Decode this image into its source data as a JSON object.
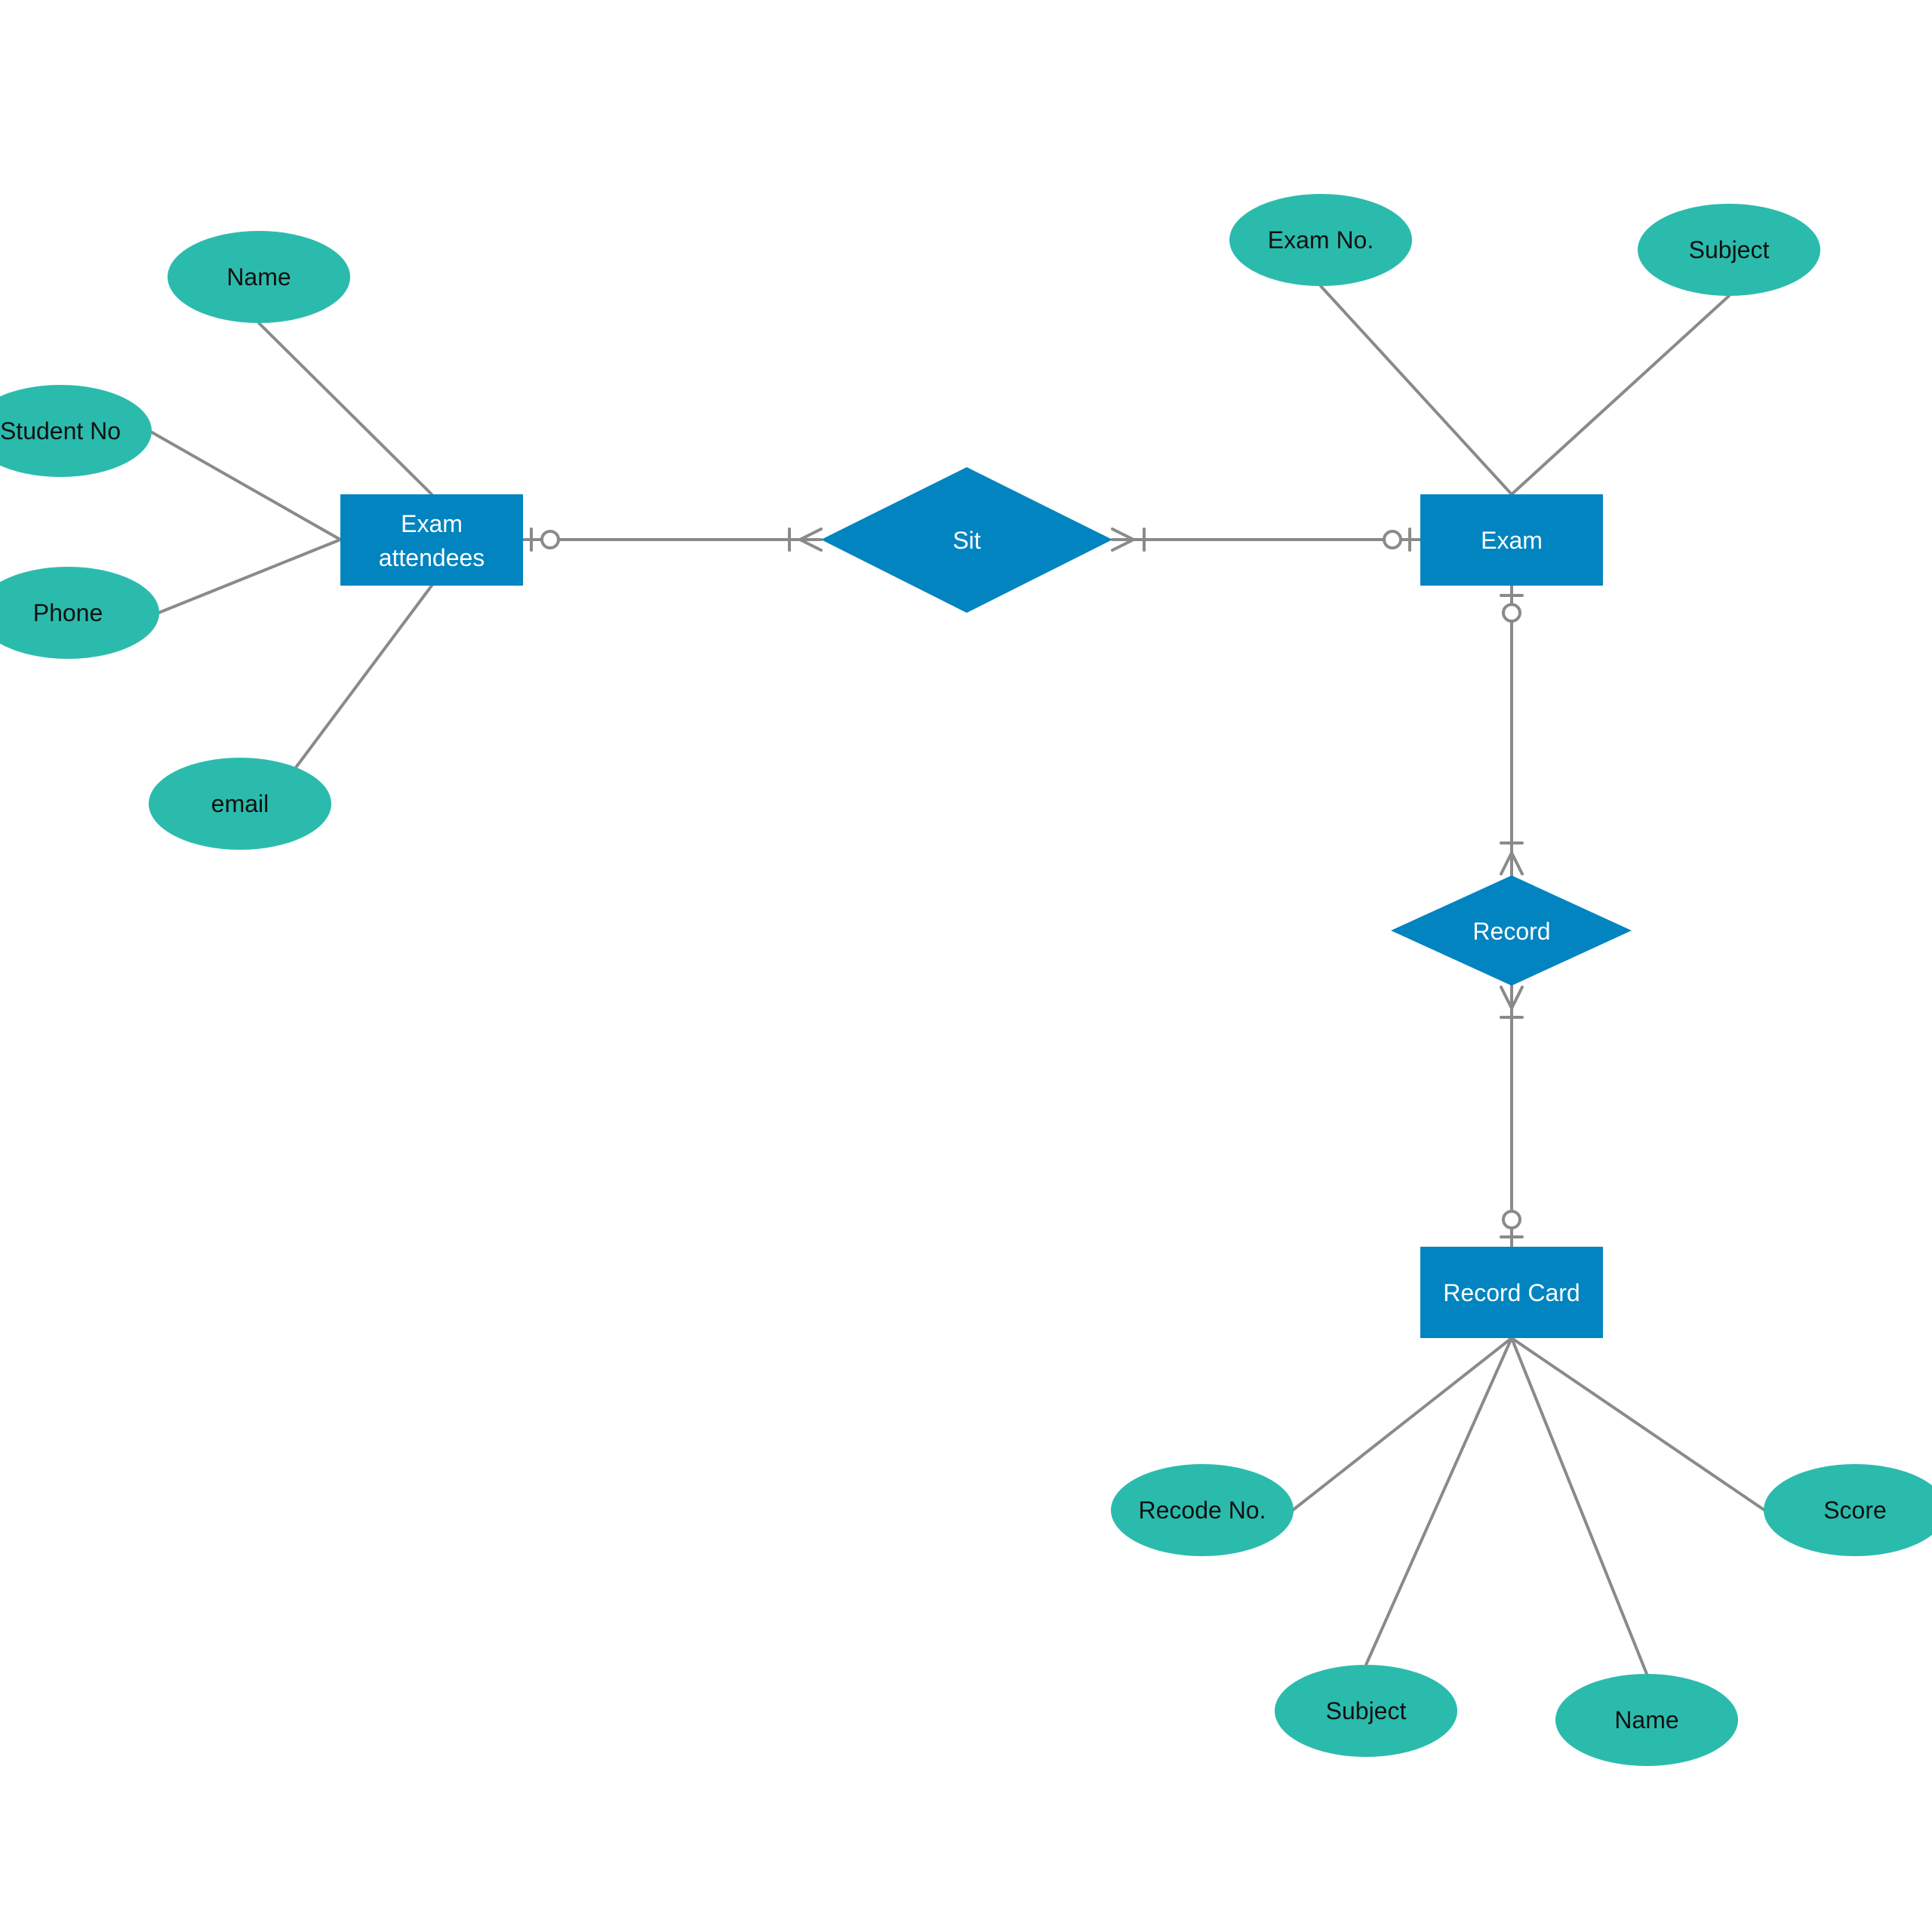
{
  "diagram": {
    "type": "Entity-Relationship diagram",
    "colors": {
      "attribute_fill": "#2bbbad",
      "entity_fill": "#0284c0",
      "relationship_fill": "#0284c0",
      "connector": "#8a8a8a",
      "attribute_text": "#111111",
      "entity_text": "#ffffff",
      "background": "#ffffff"
    },
    "entities": {
      "exam_attendees": {
        "line1": "Exam",
        "line2": "attendees"
      },
      "exam": {
        "label": "Exam"
      },
      "record_card": {
        "label": "Record Card"
      }
    },
    "relationships": {
      "sit": {
        "label": "Sit"
      },
      "record": {
        "label": "Record"
      }
    },
    "attributes": {
      "exam_attendees": {
        "name": "Name",
        "student_no": "Student No",
        "phone": "Phone",
        "email": "email"
      },
      "exam": {
        "exam_no": "Exam No.",
        "subject": "Subject"
      },
      "record_card": {
        "recode_no": "Recode No.",
        "subject": "Subject",
        "name": "Name",
        "score": "Score"
      }
    },
    "cardinalities": {
      "exam_attendees_to_sit": {
        "entity_end": "zero-or-one",
        "relationship_end": "one-or-many"
      },
      "sit_to_exam": {
        "relationship_end": "one-or-many",
        "entity_end": "zero-or-one"
      },
      "exam_to_record": {
        "entity_end": "zero-or-one",
        "relationship_end": "one-or-many"
      },
      "record_to_record_card": {
        "relationship_end": "one-or-many",
        "entity_end": "zero-or-one"
      }
    }
  }
}
